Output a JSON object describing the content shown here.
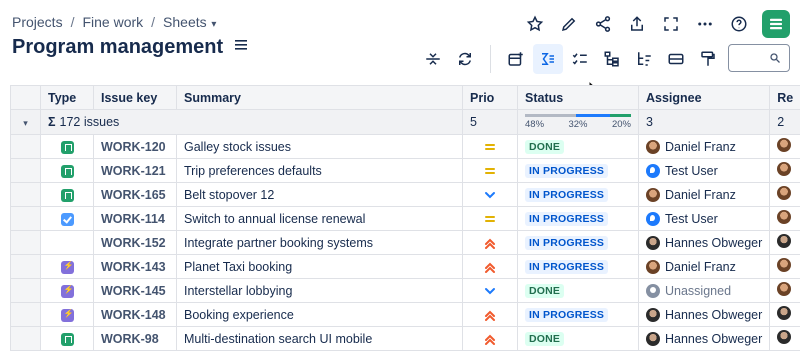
{
  "breadcrumb": {
    "items": [
      "Projects",
      "Fine work",
      "Sheets"
    ],
    "separator": "/"
  },
  "page": {
    "title": "Program management"
  },
  "brand_color": "#22a06b",
  "top_actions": [
    "star-icon",
    "pencil-icon",
    "share-icon",
    "export-icon",
    "fullscreen-icon",
    "more-icon",
    "help-icon"
  ],
  "toolbar": {
    "left": [
      "collapse-rows-icon",
      "refresh-icon"
    ],
    "right": [
      "add-view-icon",
      "sum-icon",
      "checklist-icon",
      "hierarchy-icon",
      "hierarchy-sort-icon",
      "card-icon",
      "format-paint-icon"
    ],
    "active": "sum-icon"
  },
  "search": {
    "placeholder": ""
  },
  "columns": [
    "Type",
    "Issue key",
    "Summary",
    "Prio",
    "Status",
    "Assignee",
    "Re"
  ],
  "summary_row": {
    "sigma": "Σ",
    "count": "172 issues",
    "prio": "5",
    "assignee": "3",
    "reporter": "2",
    "status_progress": [
      {
        "label": "48%",
        "value": 0.48,
        "color": "#b3b9c4"
      },
      {
        "label": "32%",
        "value": 0.32,
        "color": "#1d7afc"
      },
      {
        "label": "20%",
        "value": 0.2,
        "color": "#22a06b"
      }
    ]
  },
  "rows": [
    {
      "type": "story",
      "key": "WORK-120",
      "summary": "Galley stock issues",
      "prio": "medium",
      "status": "DONE",
      "assignee": "Daniel Franz",
      "avatar": "photo"
    },
    {
      "type": "story",
      "key": "WORK-121",
      "summary": "Trip preferences defaults",
      "prio": "medium",
      "status": "IN PROGRESS",
      "assignee": "Test User",
      "avatar": "blue"
    },
    {
      "type": "story",
      "key": "WORK-165",
      "summary": "Belt stopover 12",
      "prio": "low",
      "status": "IN PROGRESS",
      "assignee": "Daniel Franz",
      "avatar": "photo"
    },
    {
      "type": "task",
      "key": "WORK-114",
      "summary": "Switch to annual license renewal",
      "prio": "medium",
      "status": "IN PROGRESS",
      "assignee": "Test User",
      "avatar": "blue"
    },
    {
      "type": "subtask",
      "key": "WORK-152",
      "summary": "Integrate partner booking systems",
      "prio": "high",
      "status": "IN PROGRESS",
      "assignee": "Hannes Obweger",
      "avatar": "dark"
    },
    {
      "type": "epic",
      "key": "WORK-143",
      "summary": "Planet Taxi booking",
      "prio": "high",
      "status": "IN PROGRESS",
      "assignee": "Daniel Franz",
      "avatar": "photo"
    },
    {
      "type": "epic",
      "key": "WORK-145",
      "summary": "Interstellar lobbying",
      "prio": "low",
      "status": "DONE",
      "assignee": "Unassigned",
      "avatar": "gray"
    },
    {
      "type": "epic",
      "key": "WORK-148",
      "summary": "Booking experience",
      "prio": "high",
      "status": "IN PROGRESS",
      "assignee": "Hannes Obweger",
      "avatar": "dark"
    },
    {
      "type": "story",
      "key": "WORK-98",
      "summary": "Multi-destination search UI mobile",
      "prio": "high",
      "status": "DONE",
      "assignee": "Hannes Obweger",
      "avatar": "dark"
    }
  ],
  "colors": {
    "medium": "#e2b203",
    "low": "#1d7afc",
    "high": "#f15b2e"
  }
}
